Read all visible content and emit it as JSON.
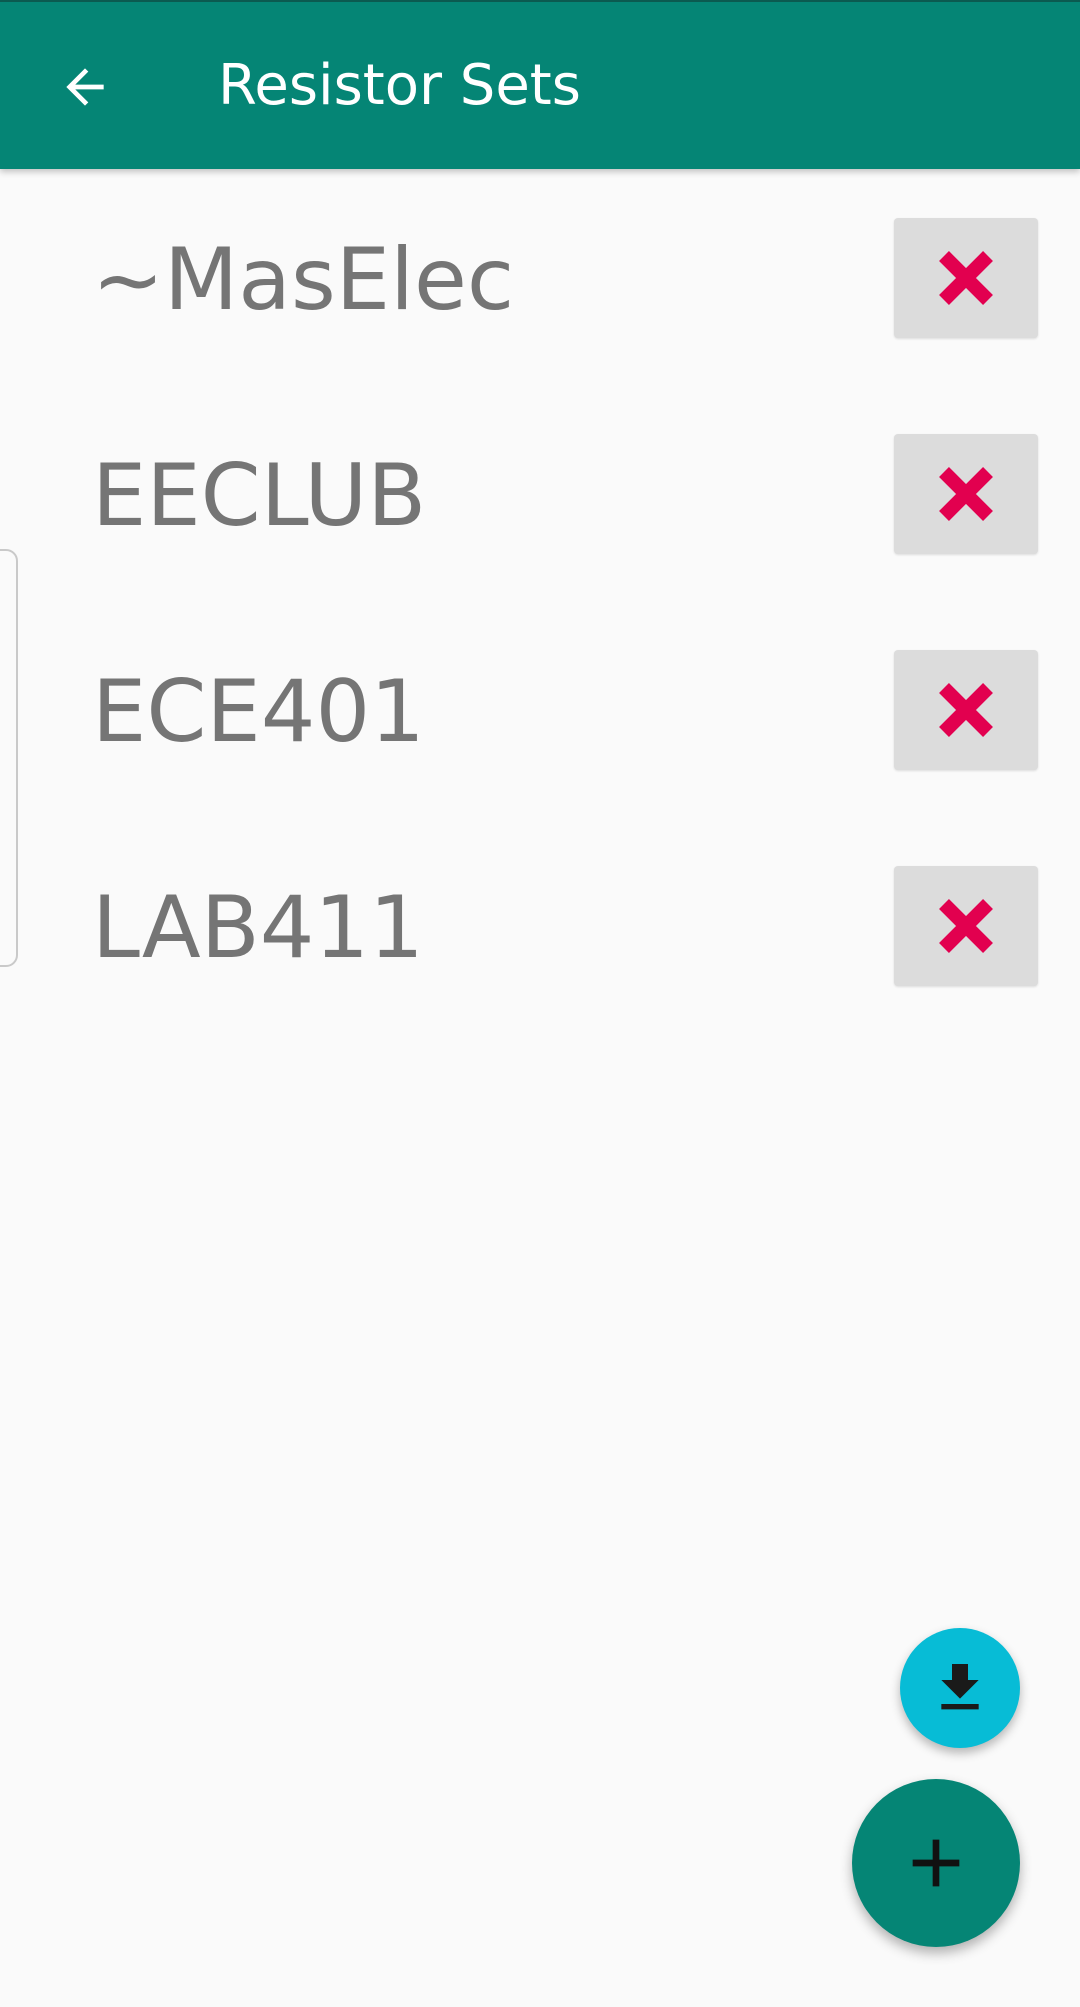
{
  "app_bar": {
    "title": "Resistor Sets",
    "back_icon": "arrow-back-icon",
    "color": "#058575"
  },
  "resistor_sets": [
    {
      "name": "~MasElec",
      "delete_icon": "close-icon"
    },
    {
      "name": "EECLUB",
      "delete_icon": "close-icon"
    },
    {
      "name": "ECE401",
      "delete_icon": "close-icon"
    },
    {
      "name": "LAB411",
      "delete_icon": "close-icon"
    }
  ],
  "fabs": {
    "import_icon": "download-icon",
    "import_color": "#07bcd6",
    "add_icon": "add-icon",
    "add_color": "#058575"
  },
  "colors": {
    "delete_mark": "#e2004f",
    "list_text": "#757575",
    "background": "#fafafa"
  }
}
